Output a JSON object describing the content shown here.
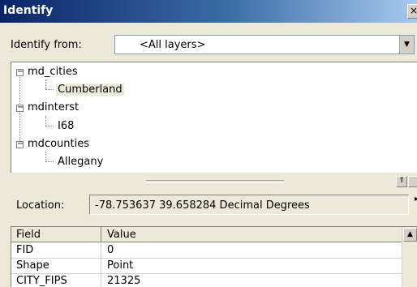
{
  "window": {
    "title": "Identify",
    "close_glyph": "×"
  },
  "identify_from": {
    "label": "Identify from:",
    "value": "<All layers>"
  },
  "tree": {
    "layers": [
      {
        "name": "md_cities",
        "feature": "Cumberland"
      },
      {
        "name": "mdinterst",
        "feature": "I68"
      },
      {
        "name": "mdcounties",
        "feature": "Allegany"
      }
    ],
    "selected_feature": "Cumberland",
    "expander_glyph": "−"
  },
  "location": {
    "label": "Location:",
    "value": "-78.753637  39.658284 Decimal Degrees"
  },
  "grid": {
    "headers": [
      "Field",
      "Value"
    ],
    "rows": [
      {
        "field": "FID",
        "value": "0"
      },
      {
        "field": "Shape",
        "value": "Point"
      },
      {
        "field": "CITY_FIPS",
        "value": "21325"
      }
    ]
  },
  "icons": {
    "dropdown": "dropdown-arrow-icon",
    "expander": "tree-collapse-icon",
    "splitter_toggle": "pin-icon",
    "scroll_up": "scroll-up-icon"
  }
}
